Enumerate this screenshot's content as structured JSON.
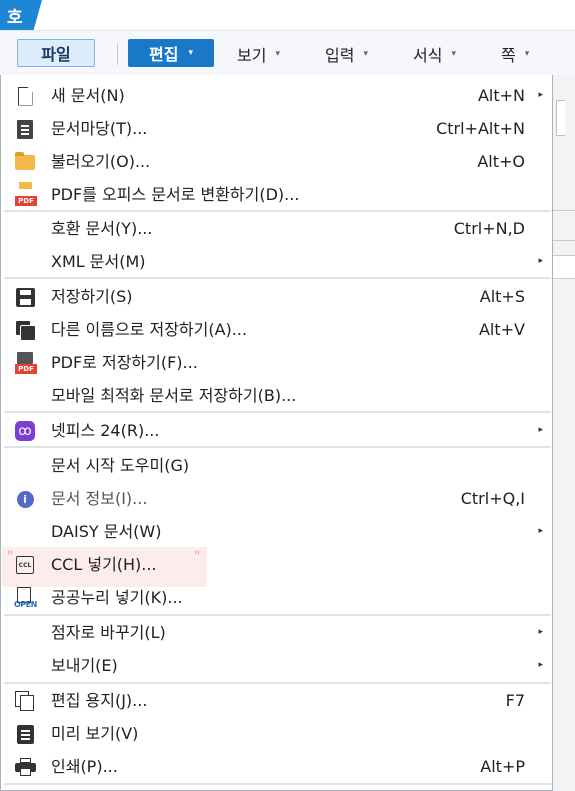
{
  "app": {
    "logo": "호"
  },
  "menubar": {
    "file": "파일",
    "edit": "편집",
    "view": "보기",
    "input": "입력",
    "format": "서식",
    "page": "쪽",
    "caret": "▾"
  },
  "file_menu": {
    "items": [
      {
        "icon": "new-document-icon",
        "label": "새 문서(N)",
        "shortcut": "Alt+N",
        "submenu": true
      },
      {
        "icon": "template-icon",
        "label": "문서마당(T)...",
        "shortcut": "Ctrl+Alt+N",
        "submenu": false
      },
      {
        "icon": "folder-open-icon",
        "label": "불러오기(O)...",
        "shortcut": "Alt+O",
        "submenu": false
      },
      {
        "icon": "pdf-convert-icon",
        "label": "PDF를 오피스 문서로 변환하기(D)...",
        "shortcut": "",
        "submenu": false
      },
      {
        "icon": "",
        "label": "호환 문서(Y)...",
        "shortcut": "Ctrl+N,D",
        "submenu": false
      },
      {
        "icon": "",
        "label": "XML 문서(M)",
        "shortcut": "",
        "submenu": true
      },
      {
        "icon": "save-icon",
        "label": "저장하기(S)",
        "shortcut": "Alt+S",
        "submenu": false
      },
      {
        "icon": "save-as-icon",
        "label": "다른 이름으로 저장하기(A)...",
        "shortcut": "Alt+V",
        "submenu": false
      },
      {
        "icon": "save-pdf-icon",
        "label": "PDF로 저장하기(F)...",
        "shortcut": "",
        "submenu": false
      },
      {
        "icon": "",
        "label": "모바일 최적화 문서로 저장하기(B)...",
        "shortcut": "",
        "submenu": false
      },
      {
        "icon": "netffice-icon",
        "label": "넷피스 24(R)...",
        "shortcut": "",
        "submenu": true
      },
      {
        "icon": "",
        "label": "문서 시작 도우미(G)",
        "shortcut": "",
        "submenu": false
      },
      {
        "icon": "info-icon",
        "label": "문서 정보(I)...",
        "shortcut": "Ctrl+Q,I",
        "submenu": false
      },
      {
        "icon": "",
        "label": "DAISY 문서(W)",
        "shortcut": "",
        "submenu": true
      },
      {
        "icon": "ccl-icon",
        "label": "CCL 넣기(H)...",
        "shortcut": "",
        "submenu": false
      },
      {
        "icon": "open-data-icon",
        "label": "공공누리 넣기(K)...",
        "shortcut": "",
        "submenu": false
      },
      {
        "icon": "",
        "label": "점자로 바꾸기(L)",
        "shortcut": "",
        "submenu": true
      },
      {
        "icon": "",
        "label": "보내기(E)",
        "shortcut": "",
        "submenu": true
      },
      {
        "icon": "page-setup-icon",
        "label": "편집 용지(J)...",
        "shortcut": "F7",
        "submenu": false
      },
      {
        "icon": "preview-icon",
        "label": "미리 보기(V)",
        "shortcut": "",
        "submenu": false
      },
      {
        "icon": "printer-icon",
        "label": "인쇄(P)...",
        "shortcut": "Alt+P",
        "submenu": false
      }
    ],
    "highlighted_index": 12,
    "submenu_arrow": "▸",
    "pdf_tag": "PDF",
    "ccl_tag": "CCL",
    "open_tag": "OPEN",
    "netffice_glyph": "ꝏ",
    "info_glyph": "i"
  }
}
